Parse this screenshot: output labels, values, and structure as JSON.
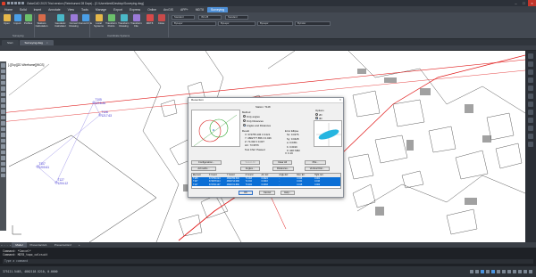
{
  "titlebar": {
    "title": "GstarCAD 2023 Trial version (Reimbursed 28 Days) - [C:\\Users\\test\\Desktop\\Surveying.dwg]"
  },
  "ribbon_tabs": [
    "Home",
    "Solid",
    "Insert",
    "Annotate",
    "View",
    "Tools",
    "Manage",
    "Export",
    "Express",
    "Online",
    "ArcGIS",
    "APP+",
    "MDT8",
    "Surveying"
  ],
  "ribbon": {
    "buttons": [
      {
        "label": "Open"
      },
      {
        "label": "Import"
      },
      {
        "label": "Profiles"
      },
      {
        "label": "Stations Calculation"
      },
      {
        "label": "Geodesic Calculator"
      },
      {
        "label": "Convert Drawing"
      },
      {
        "label": "Convert File"
      },
      {
        "label": "Local Systems"
      },
      {
        "label": "Transform Points"
      },
      {
        "label": "Transform Drawing"
      },
      {
        "label": "Transform File"
      },
      {
        "label": "MDT8"
      },
      {
        "label": "Close"
      }
    ],
    "group_labels": [
      "Surveying",
      "Coordinate Systems"
    ],
    "combos": [
      "Standard",
      "ISO-25",
      "Standard",
      "ByLayer",
      "ByLayer",
      "ByLayer",
      "ByColor"
    ]
  },
  "doc_tabs": [
    {
      "label": "Start"
    },
    {
      "label": "Surveying.dwg"
    }
  ],
  "canvas": {
    "viewport_label": "[-][Top][2D Wireframe][WCS]",
    "stations": [
      {
        "id": "T105",
        "sub": "1216.26"
      },
      {
        "id": "T128",
        "sub": "1217.63"
      },
      {
        "id": "T107",
        "sub": "1200.61"
      },
      {
        "id": "T127",
        "sub": "1204.12"
      }
    ]
  },
  "dialog": {
    "title": "Resection",
    "station": "Station: T128",
    "method_label": "Method",
    "methods": [
      "Only angles",
      "Only Distances",
      "Angles and Distances"
    ],
    "selected_method": "Angles and Distances",
    "options_label": "Options",
    "options": [
      "2D",
      "3D"
    ],
    "selected_option": "3D",
    "result_label": "Result",
    "result_lines": [
      "X: 374755.106 ± 0.021",
      "Y: 4802777.856 ± 0.026",
      "Z: 74.302 ± 0.007",
      "HC: 73.9576"
    ],
    "test_line": "Test Chi2: Passed",
    "error_ellipse_label": "Error Ellipse",
    "ellipse_lines": [
      "Sx: 0.0276",
      "Sy: 0.0428",
      "a: 0.0451",
      "b: 0.0199",
      "θ: 348.7082"
    ],
    "chi_sub": "X: 0.16",
    "buttons_row1": [
      "Configuration...",
      "Select All",
      "Clear All",
      "Plot..."
    ],
    "buttons_row2": [
      "Azimuths...",
      "Angles...",
      "Distances...",
      "Vertical Dist..."
    ],
    "table_headers": [
      "Element",
      "X Coord",
      "Y Coord",
      "Z Coord",
      "Azi. Err.",
      "Angle Err.",
      "Dist. Err.",
      "Hght. Err."
    ],
    "table_rows": [
      [
        "T105",
        "374756.024",
        "4802780.503",
        "73.093",
        "0.0024",
        "-",
        "0.026",
        "0.001"
      ],
      [
        "T107",
        "374678.914",
        "4802714.099",
        "72.192",
        "0.0016",
        "-",
        "0.021",
        "0.010"
      ],
      [
        "T127",
        "374784.107",
        "4802721.866",
        "73.402",
        "0.0033",
        "-",
        "0.015",
        "0.002"
      ]
    ],
    "footer_buttons": [
      "OK",
      "Cancel",
      "Help..."
    ]
  },
  "layout_tabs": [
    "Model",
    "Presentación1",
    "Presentación2"
  ],
  "command": {
    "lines": [
      "Command: *Cancel*",
      "Command: MDT8_topo_calcsuit"
    ],
    "input_placeholder": "Type a command"
  },
  "status": {
    "coords": "375121.5463, 4802118.5210, 0.0000"
  },
  "colors": {
    "accent": "#4e8fd6",
    "survey_line": "#e01818",
    "selection": "#0b6fd6"
  }
}
